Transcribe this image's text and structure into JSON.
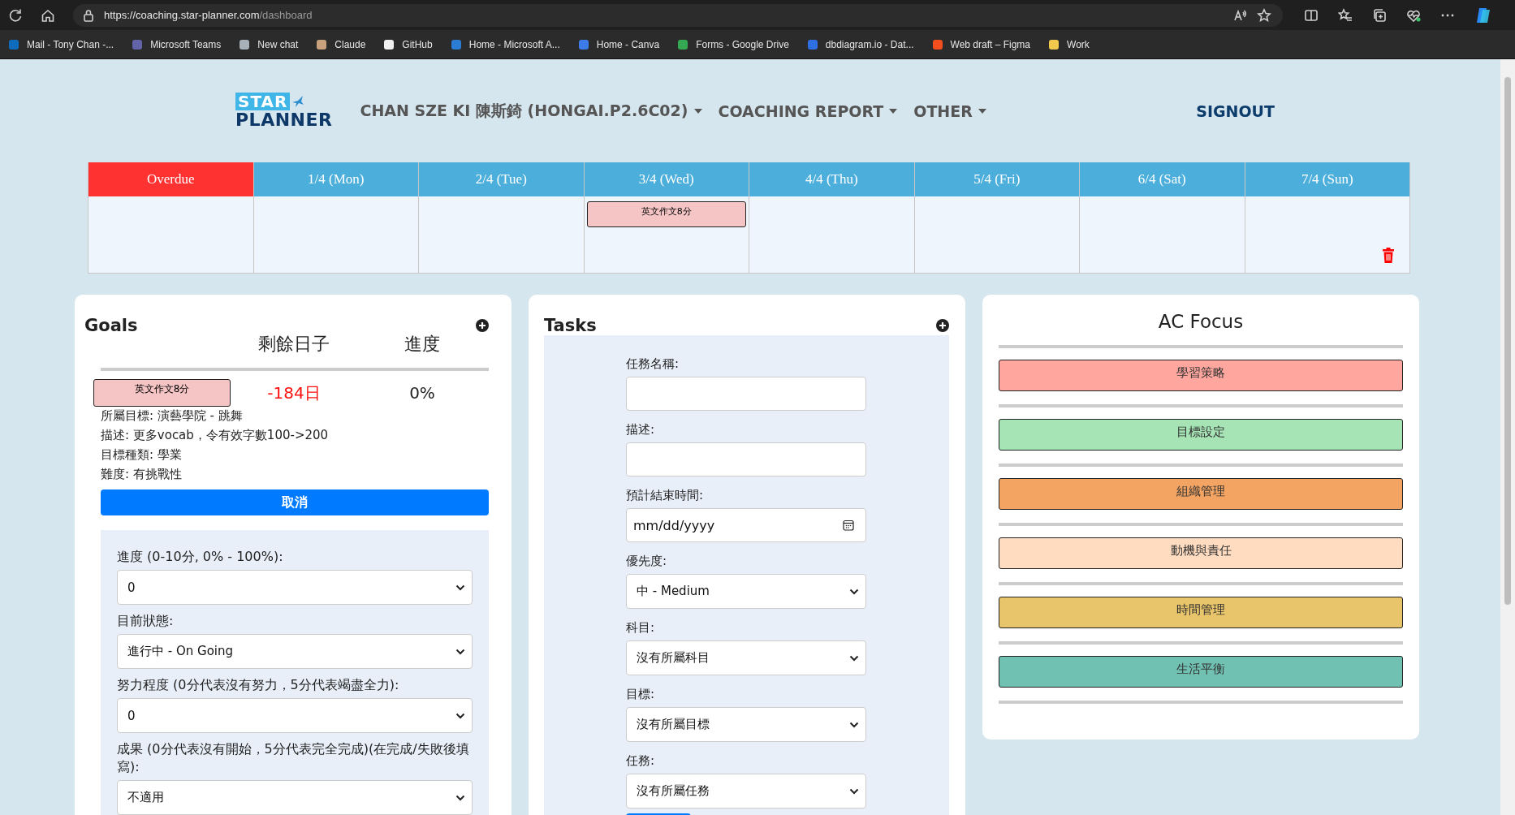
{
  "browser": {
    "url_host": "https://coaching.star-planner.com",
    "url_path": "/dashboard",
    "bookmarks": [
      {
        "label": "Mail - Tony Chan -...",
        "color": "#0f6cbd"
      },
      {
        "label": "Microsoft Teams",
        "color": "#6264a7"
      },
      {
        "label": "New chat",
        "color": "#a8b0b8"
      },
      {
        "label": "Claude",
        "color": "#c8a27c"
      },
      {
        "label": "GitHub",
        "color": "#f0f0f0"
      },
      {
        "label": "Home - Microsoft A...",
        "color": "#2b7cd3"
      },
      {
        "label": "Home - Canva",
        "color": "#3d7be8"
      },
      {
        "label": "Forms - Google Drive",
        "color": "#34a853"
      },
      {
        "label": "dbdiagram.io - Dat...",
        "color": "#2f6fe4"
      },
      {
        "label": "Web draft – Figma",
        "color": "#f24e1e"
      },
      {
        "label": "Work",
        "color": "#f2c94c"
      }
    ]
  },
  "header": {
    "logo": {
      "line1": "STAR",
      "line2": "PLANNER"
    },
    "nav": [
      {
        "label": "CHAN SZE KI 陳斯錡 (HONGAI.P2.6C02)",
        "dropdown": true
      },
      {
        "label": "COACHING REPORT",
        "dropdown": true
      },
      {
        "label": "OTHER",
        "dropdown": true
      }
    ],
    "signout": "SIGNOUT"
  },
  "calendar": {
    "columns": [
      {
        "label": "Overdue",
        "kind": "overdue"
      },
      {
        "label": "1/4 (Mon)",
        "kind": "day"
      },
      {
        "label": "2/4 (Tue)",
        "kind": "day"
      },
      {
        "label": "3/4 (Wed)",
        "kind": "day",
        "events": [
          {
            "label": "英文作文8分"
          }
        ]
      },
      {
        "label": "4/4 (Thu)",
        "kind": "day"
      },
      {
        "label": "5/4 (Fri)",
        "kind": "day"
      },
      {
        "label": "6/4 (Sat)",
        "kind": "day"
      },
      {
        "label": "7/4 (Sun)",
        "kind": "day"
      }
    ]
  },
  "goals": {
    "title": "Goals",
    "columns": [
      "剩餘日子",
      "進度"
    ],
    "items": [
      {
        "chip": "英文作文8分",
        "remaining": "-184日",
        "overdue": true,
        "progress": "0%",
        "details": [
          "所屬目標: 演藝學院 - 跳舞",
          "描述: 更多vocab，令有效字數100->200",
          "目標種類: 學業",
          "難度: 有挑戰性"
        ],
        "cancel": "取消",
        "form": [
          {
            "label": "進度 (0-10分, 0% - 100%):",
            "value": "0"
          },
          {
            "label": "目前狀態:",
            "value": "進行中 - On Going"
          },
          {
            "label": "努力程度 (0分代表沒有努力，5分代表竭盡全力):",
            "value": "0"
          },
          {
            "label": "成果 (0分代表沒有開始，5分代表完全完成)(在完成/失敗後填寫):",
            "value": "不適用"
          }
        ]
      }
    ]
  },
  "tasks": {
    "title": "Tasks",
    "fields": [
      {
        "label": "任務名稱:",
        "kind": "text"
      },
      {
        "label": "描述:",
        "kind": "text"
      },
      {
        "label": "預計結束時間:",
        "kind": "date",
        "placeholder": "mm/dd/yyyy"
      },
      {
        "label": "優先度:",
        "kind": "select",
        "value": "中 - Medium"
      },
      {
        "label": "科目:",
        "kind": "select",
        "value": "沒有所屬科目"
      },
      {
        "label": "目標:",
        "kind": "select",
        "value": "沒有所屬目標"
      },
      {
        "label": "任務:",
        "kind": "select",
        "value": "沒有所屬任務"
      }
    ]
  },
  "ac_focus": {
    "title": "AC Focus",
    "items": [
      {
        "label": "學習策略",
        "color": "#ffa69e"
      },
      {
        "label": "目標設定",
        "color": "#a6e4b5"
      },
      {
        "label": "組織管理",
        "color": "#f3a462"
      },
      {
        "label": "動機與責任",
        "color": "#ffdcbf"
      },
      {
        "label": "時間管理",
        "color": "#e8c46a"
      },
      {
        "label": "生活平衡",
        "color": "#71c1b3"
      }
    ]
  }
}
